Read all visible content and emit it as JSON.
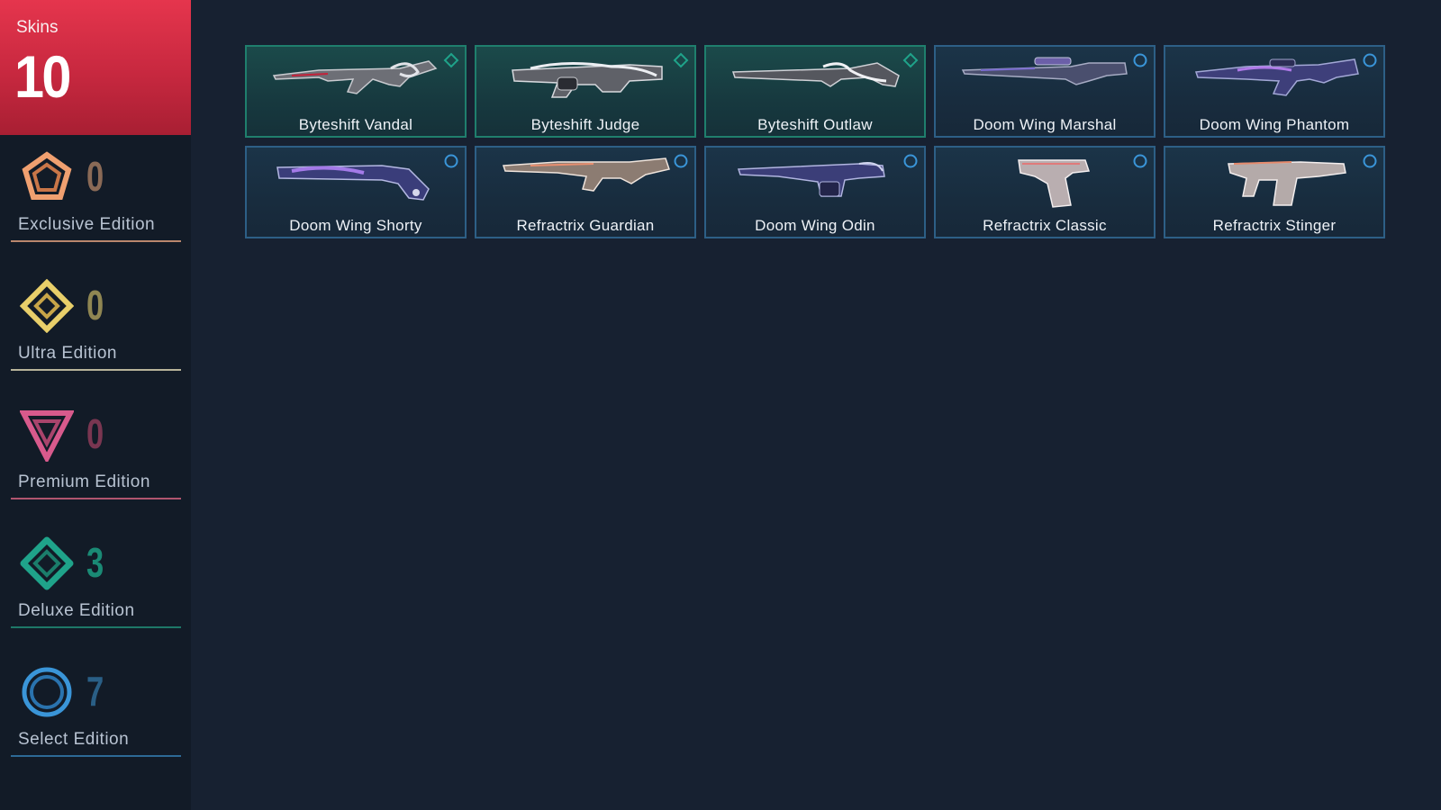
{
  "total": {
    "label": "Skins",
    "count": "10",
    "accent": "#d93048"
  },
  "editions": [
    {
      "name": "Exclusive Edition",
      "count": "0",
      "color": "#f0a070",
      "icon": "exclusive-edition-icon"
    },
    {
      "name": "Ultra Edition",
      "count": "0",
      "color": "#e8cf6a",
      "icon": "ultra-edition-icon"
    },
    {
      "name": "Premium Edition",
      "count": "0",
      "color": "#d85a8c",
      "icon": "premium-edition-icon"
    },
    {
      "name": "Deluxe Edition",
      "count": "3",
      "color": "#1fa38a",
      "icon": "deluxe-edition-icon"
    },
    {
      "name": "Select Edition",
      "count": "7",
      "color": "#3a95d8",
      "icon": "select-edition-icon"
    }
  ],
  "skins": [
    {
      "name": "Byteshift Vandal",
      "edition": "deluxe",
      "weapon": "rifle-icon"
    },
    {
      "name": "Byteshift Judge",
      "edition": "deluxe",
      "weapon": "shotgun-icon"
    },
    {
      "name": "Byteshift Outlaw",
      "edition": "deluxe",
      "weapon": "sniper-icon"
    },
    {
      "name": "Doom Wing Marshal",
      "edition": "select",
      "weapon": "sniper-icon"
    },
    {
      "name": "Doom Wing Phantom",
      "edition": "select",
      "weapon": "rifle-icon"
    },
    {
      "name": "Doom Wing Shorty",
      "edition": "select",
      "weapon": "shotgun-icon"
    },
    {
      "name": "Refractrix Guardian",
      "edition": "select",
      "weapon": "rifle-icon"
    },
    {
      "name": "Doom Wing Odin",
      "edition": "select",
      "weapon": "machine-gun-icon"
    },
    {
      "name": "Refractrix Classic",
      "edition": "select",
      "weapon": "pistol-icon"
    },
    {
      "name": "Refractrix Stinger",
      "edition": "select",
      "weapon": "smg-icon"
    }
  ]
}
